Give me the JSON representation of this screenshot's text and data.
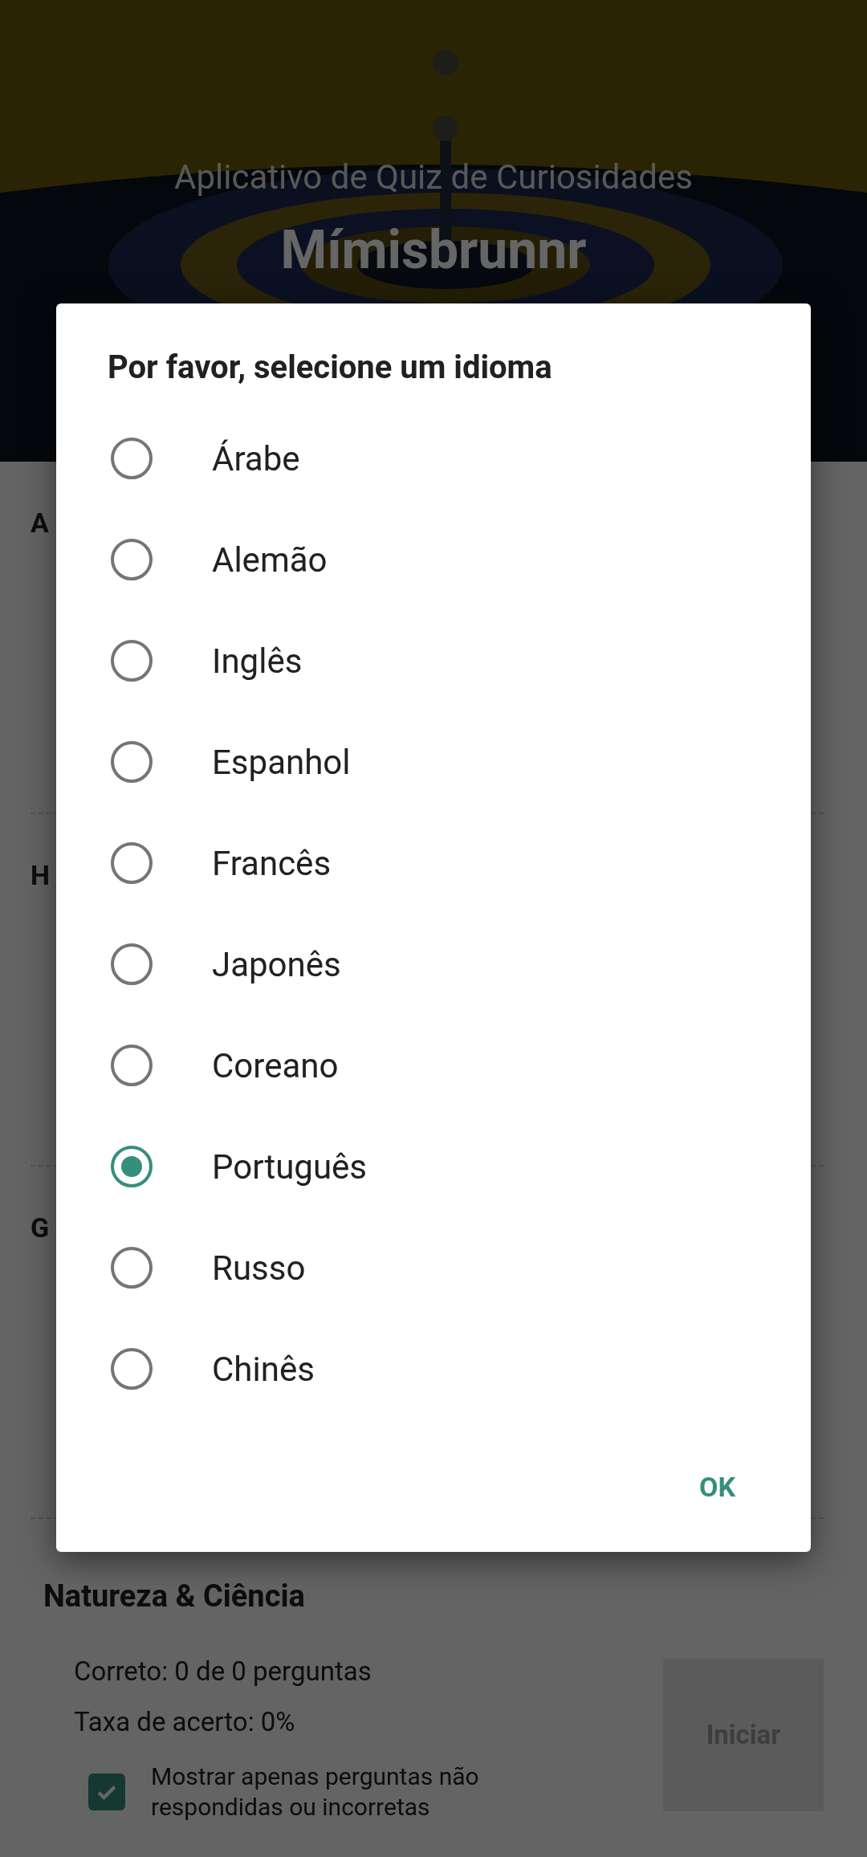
{
  "header": {
    "subtitle": "Aplicativo de Quiz de Curiosidades",
    "title": "Mímisbrunnr"
  },
  "sections": [
    {
      "title": "A"
    },
    {
      "title": "H"
    },
    {
      "title": "G"
    },
    {
      "title": "Natureza & Ciência",
      "correct": "Correto: 0 de 0 perguntas",
      "rate": "Taxa de acerto: 0%",
      "filter": {
        "label": "Mostrar apenas perguntas não respondidas ou incorretas",
        "checked": true
      },
      "button": {
        "label": "Iniciar",
        "disabled": true
      }
    }
  ],
  "dialog": {
    "title": "Por favor, selecione um idioma",
    "options": [
      {
        "label": "Árabe",
        "selected": false
      },
      {
        "label": "Alemão",
        "selected": false
      },
      {
        "label": "Inglês",
        "selected": false
      },
      {
        "label": "Espanhol",
        "selected": false
      },
      {
        "label": "Francês",
        "selected": false
      },
      {
        "label": "Japonês",
        "selected": false
      },
      {
        "label": "Coreano",
        "selected": false
      },
      {
        "label": "Português",
        "selected": true
      },
      {
        "label": "Russo",
        "selected": false
      },
      {
        "label": "Chinês",
        "selected": false
      }
    ],
    "button": "OK"
  }
}
